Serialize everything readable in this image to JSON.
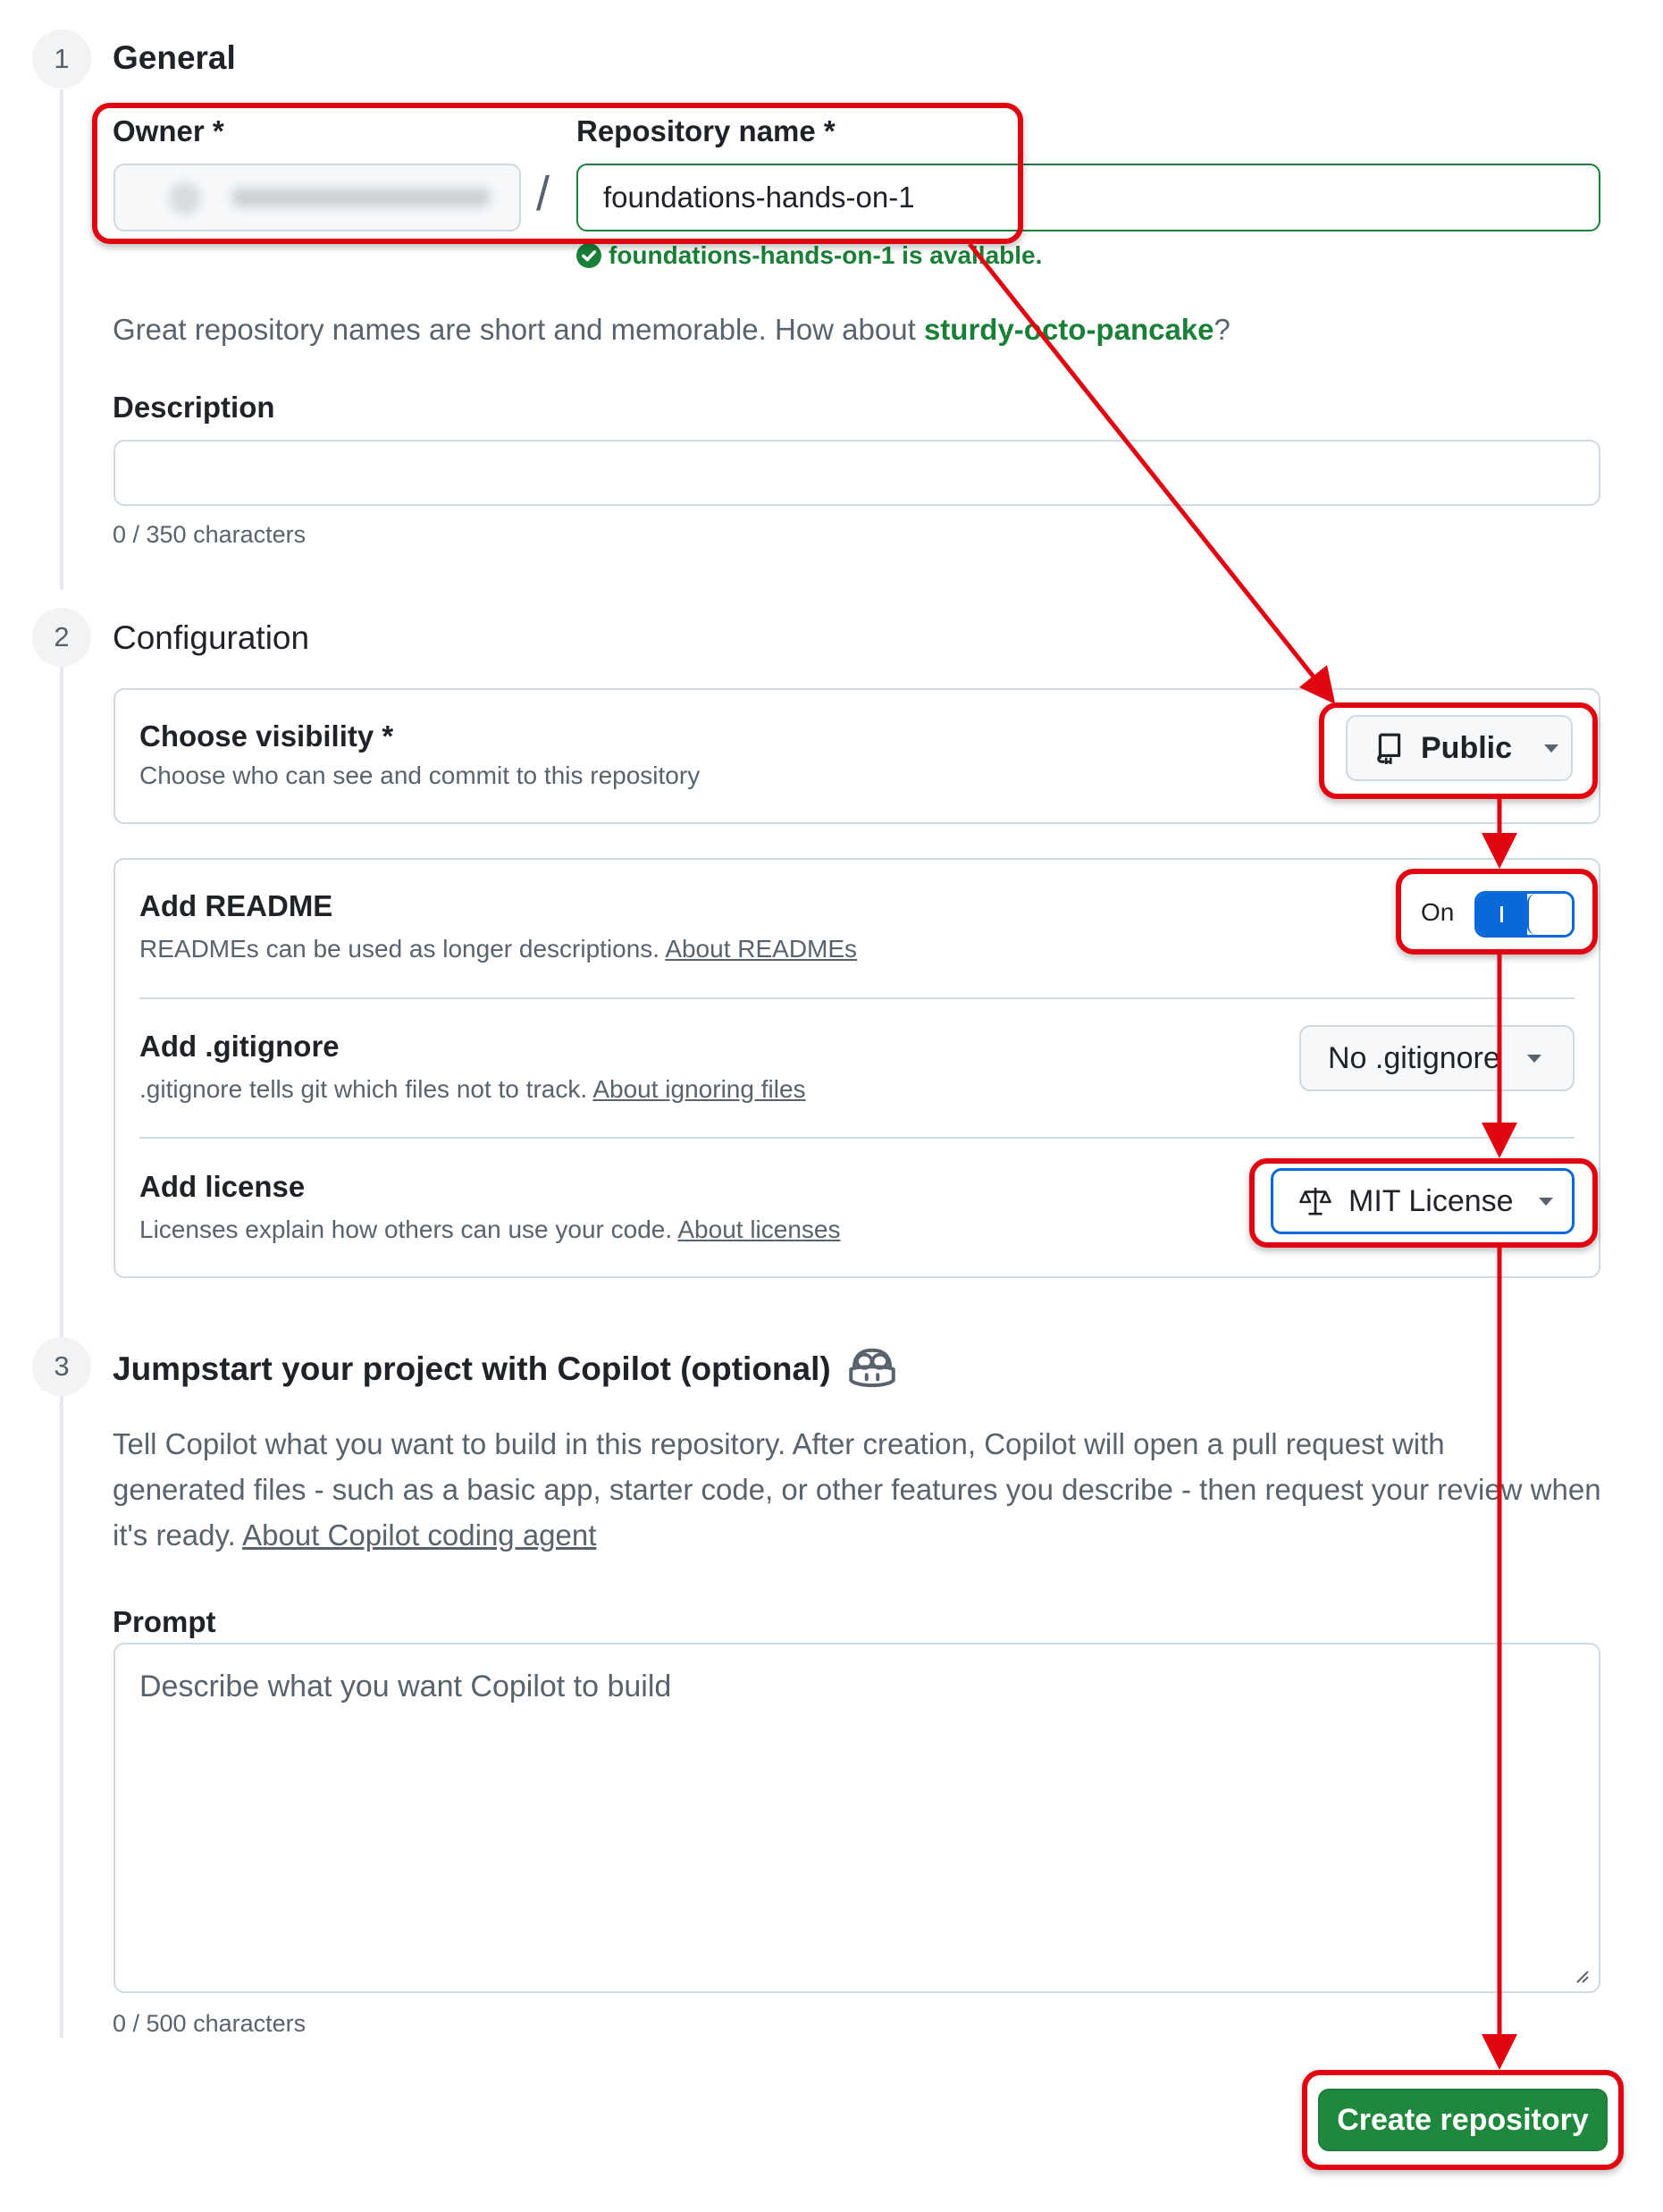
{
  "steps": {
    "one": {
      "number": "1",
      "title": "General"
    },
    "two": {
      "number": "2",
      "title": "Configuration"
    },
    "three": {
      "number": "3",
      "title": "Jumpstart your project with Copilot (optional)"
    }
  },
  "general": {
    "owner_label": "Owner *",
    "repo_label": "Repository name *",
    "slash": "/",
    "repo_value": "foundations-hands-on-1",
    "availability": "foundations-hands-on-1 is available.",
    "suggestion_prefix": "Great repository names are short and memorable. How about ",
    "suggestion_name": "sturdy-octo-pancake",
    "suggestion_suffix": "?",
    "description_label": "Description",
    "description_counter": "0 / 350 characters"
  },
  "configuration": {
    "visibility_title": "Choose visibility *",
    "visibility_desc": "Choose who can see and commit to this repository",
    "visibility_value": "Public",
    "readme_title": "Add README",
    "readme_desc": "READMEs can be used as longer descriptions.",
    "readme_link": "About READMEs",
    "readme_toggle_label": "On",
    "gitignore_title": "Add .gitignore",
    "gitignore_desc": ".gitignore tells git which files not to track.",
    "gitignore_link": "About ignoring files",
    "gitignore_value": "No .gitignore",
    "license_title": "Add license",
    "license_desc": "Licenses explain how others can use your code.",
    "license_link": "About licenses",
    "license_value": "MIT License"
  },
  "copilot": {
    "intro_line1": "Tell Copilot what you want to build in this repository. After creation, Copilot will open a pull request with",
    "intro_line2": "generated files - such as a basic app, starter code, or other features you describe - then request your review when",
    "intro_line3_prefix": "it's ready.",
    "intro_link": "About Copilot coding agent",
    "prompt_label": "Prompt",
    "prompt_placeholder": "Describe what you want Copilot to build",
    "prompt_counter": "0 / 500 characters"
  },
  "actions": {
    "create_label": "Create repository"
  },
  "colors": {
    "annotation": "#e10512",
    "success_green": "#1a7f37",
    "primary_button": "#1f883d",
    "toggle_blue": "#0969da"
  },
  "icons": [
    "repo-icon",
    "law-icon",
    "copilot-icon",
    "check-circle-icon",
    "caret-down-icon",
    "resize-handle-icon"
  ]
}
